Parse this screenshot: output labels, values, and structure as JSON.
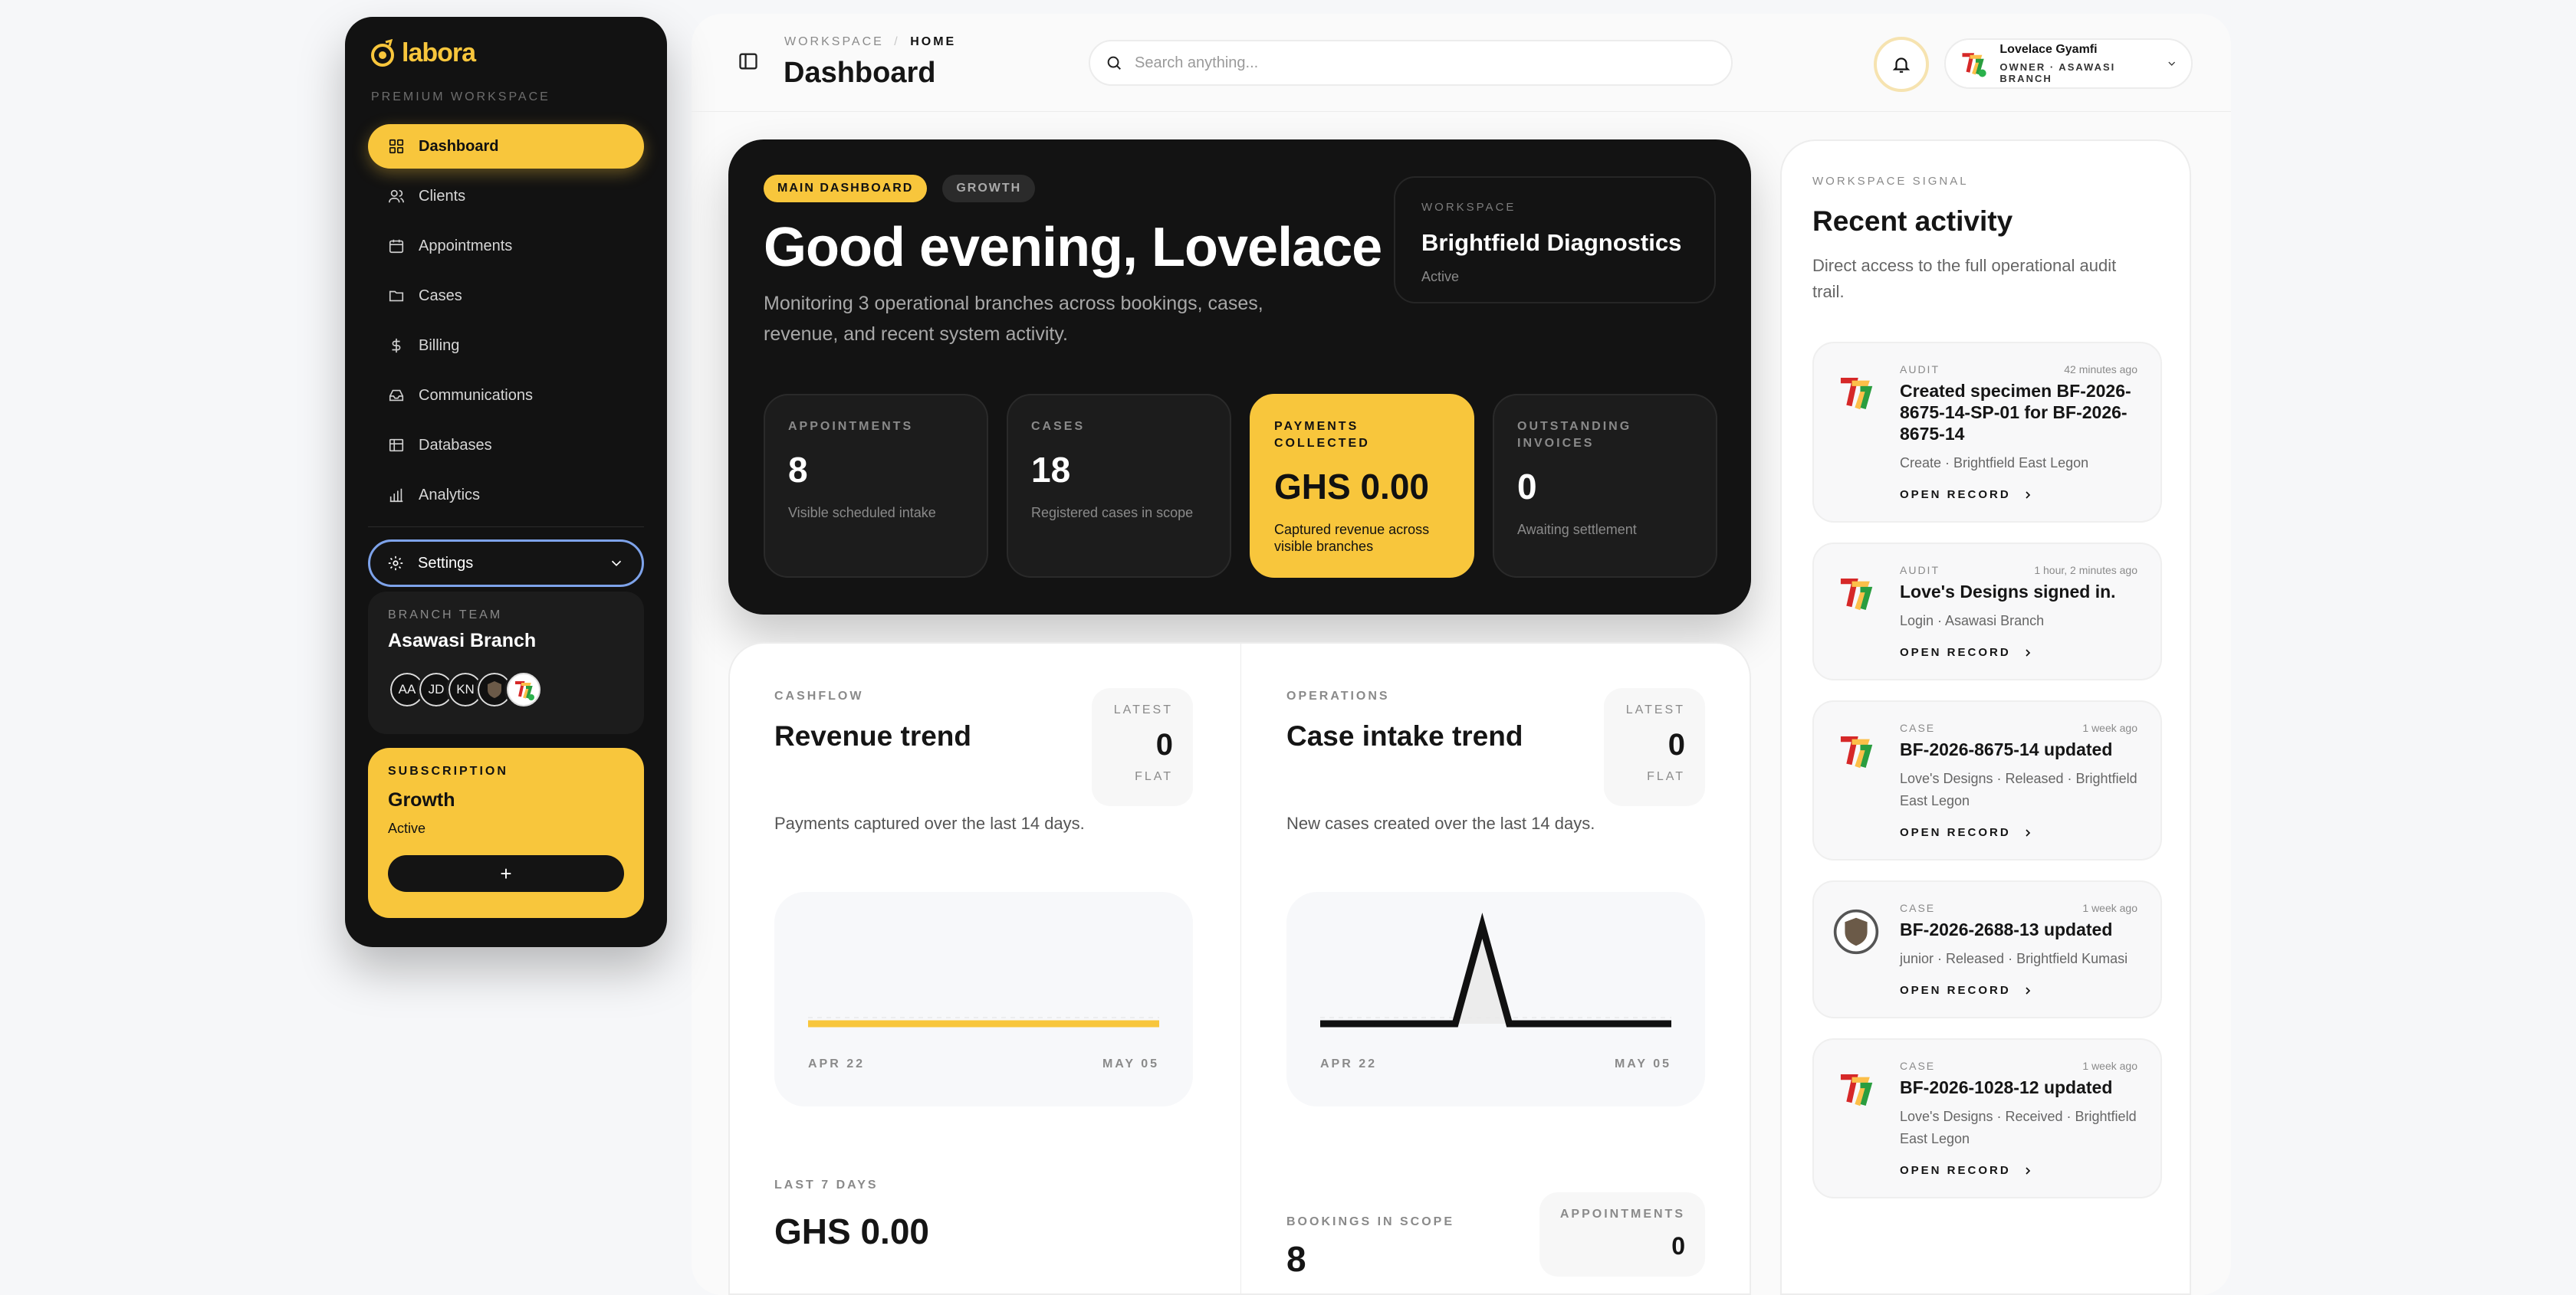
{
  "brand": {
    "name": "labora",
    "subtitle": "PREMIUM WORKSPACE",
    "accent": "#f8c63c"
  },
  "sidebar": {
    "items": [
      {
        "label": "Dashboard",
        "icon": "grid-icon",
        "active": true
      },
      {
        "label": "Clients",
        "icon": "users-icon"
      },
      {
        "label": "Appointments",
        "icon": "calendar-icon"
      },
      {
        "label": "Cases",
        "icon": "folder-icon"
      },
      {
        "label": "Billing",
        "icon": "dollar-icon"
      },
      {
        "label": "Communications",
        "icon": "inbox-icon"
      },
      {
        "label": "Databases",
        "icon": "table-icon"
      },
      {
        "label": "Analytics",
        "icon": "bar-chart-icon"
      }
    ],
    "settings_label": "Settings",
    "branch": {
      "label": "BRANCH TEAM",
      "name": "Asawasi Branch",
      "members": [
        "AA",
        "JD",
        "KN",
        "",
        ""
      ]
    },
    "subscription": {
      "label": "SUBSCRIPTION",
      "plan": "Growth",
      "status": "Active",
      "button": "+"
    }
  },
  "header": {
    "crumb_root": "WORKSPACE",
    "crumb_sep": "/",
    "crumb_current": "HOME",
    "title": "Dashboard",
    "search_placeholder": "Search anything...",
    "user": {
      "name": "Lovelace Gyamfi",
      "role": "OWNER · ASAWASI BRANCH"
    }
  },
  "hero": {
    "pill_primary": "MAIN DASHBOARD",
    "pill_secondary": "GROWTH",
    "greeting": "Good evening, Lovelace",
    "subtitle": "Monitoring 3 operational branches across bookings, cases, revenue, and recent system activity.",
    "workspace": {
      "label": "WORKSPACE",
      "name": "Brightfield Diagnostics",
      "status": "Active"
    },
    "stats": [
      {
        "label": "APPOINTMENTS",
        "value": "8",
        "sub": "Visible scheduled intake"
      },
      {
        "label": "CASES",
        "value": "18",
        "sub": "Registered cases in scope"
      },
      {
        "label": "PAYMENTS COLLECTED",
        "value": "GHS 0.00",
        "sub": "Captured revenue across visible branches"
      },
      {
        "label": "OUTSTANDING INVOICES",
        "value": "0",
        "sub": "Awaiting settlement"
      }
    ]
  },
  "revenue": {
    "label": "CASHFLOW",
    "title": "Revenue trend",
    "latest_label": "LATEST",
    "latest_value": "0",
    "latest_trend": "FLAT",
    "desc": "Payments captured over the last 14 days.",
    "x_start": "APR 22",
    "x_end": "MAY 05",
    "foot_label": "LAST 7 DAYS",
    "foot_value": "GHS 0.00"
  },
  "intake": {
    "label": "OPERATIONS",
    "title": "Case intake trend",
    "latest_label": "LATEST",
    "latest_value": "0",
    "latest_trend": "FLAT",
    "desc": "New cases created over the last 14 days.",
    "x_start": "APR 22",
    "x_end": "MAY 05",
    "foot_label": "BOOKINGS IN SCOPE",
    "foot_value": "8",
    "appt_label": "APPOINTMENTS",
    "appt_value": "0"
  },
  "chart_data": [
    {
      "type": "line",
      "title": "Revenue trend",
      "x": [
        "Apr 22",
        "Apr 23",
        "Apr 24",
        "Apr 25",
        "Apr 26",
        "Apr 27",
        "Apr 28",
        "Apr 29",
        "Apr 30",
        "May 01",
        "May 02",
        "May 03",
        "May 04",
        "May 05"
      ],
      "series": [
        {
          "values": [
            0,
            0,
            0,
            0,
            0,
            0,
            0,
            0,
            0,
            0,
            0,
            0,
            0,
            0
          ],
          "color": "#f8c63c"
        }
      ]
    },
    {
      "type": "line",
      "title": "Case intake trend",
      "x": [
        "Apr 22",
        "Apr 23",
        "Apr 24",
        "Apr 25",
        "Apr 26",
        "Apr 27",
        "Apr 28",
        "Apr 29",
        "Apr 30",
        "May 01",
        "May 02",
        "May 03",
        "May 04",
        "May 05"
      ],
      "series": [
        {
          "values": [
            0,
            0,
            0,
            0,
            0,
            0,
            1,
            0,
            0,
            0,
            0,
            0,
            0,
            0
          ],
          "color": "#111111"
        }
      ]
    }
  ],
  "activity": {
    "label": "WORKSPACE SIGNAL",
    "title": "Recent activity",
    "desc": "Direct access to the full operational audit trail.",
    "open_label": "OPEN RECORD",
    "items": [
      {
        "type": "AUDIT",
        "time": "42 minutes ago",
        "title": "Created specimen BF-2026-8675-14-SP-01 for BF-2026-8675-14",
        "meta": "Create · Brightfield East Legon",
        "icon": "flag-logo-icon"
      },
      {
        "type": "AUDIT",
        "time": "1 hour, 2 minutes ago",
        "title": "Love's Designs signed in.",
        "meta": "Login · Asawasi Branch",
        "icon": "flag-logo-icon"
      },
      {
        "type": "CASE",
        "time": "1 week ago",
        "title": "BF-2026-8675-14 updated",
        "meta": "Love's Designs · Released · Brightfield East Legon",
        "icon": "flag-logo-icon"
      },
      {
        "type": "CASE",
        "time": "1 week ago",
        "title": "BF-2026-2688-13 updated",
        "meta": "junior · Released · Brightfield Kumasi",
        "icon": "crest-avatar-icon"
      },
      {
        "type": "CASE",
        "time": "1 week ago",
        "title": "BF-2026-1028-12 updated",
        "meta": "Love's Designs · Received · Brightfield East Legon",
        "icon": "flag-logo-icon"
      }
    ]
  }
}
